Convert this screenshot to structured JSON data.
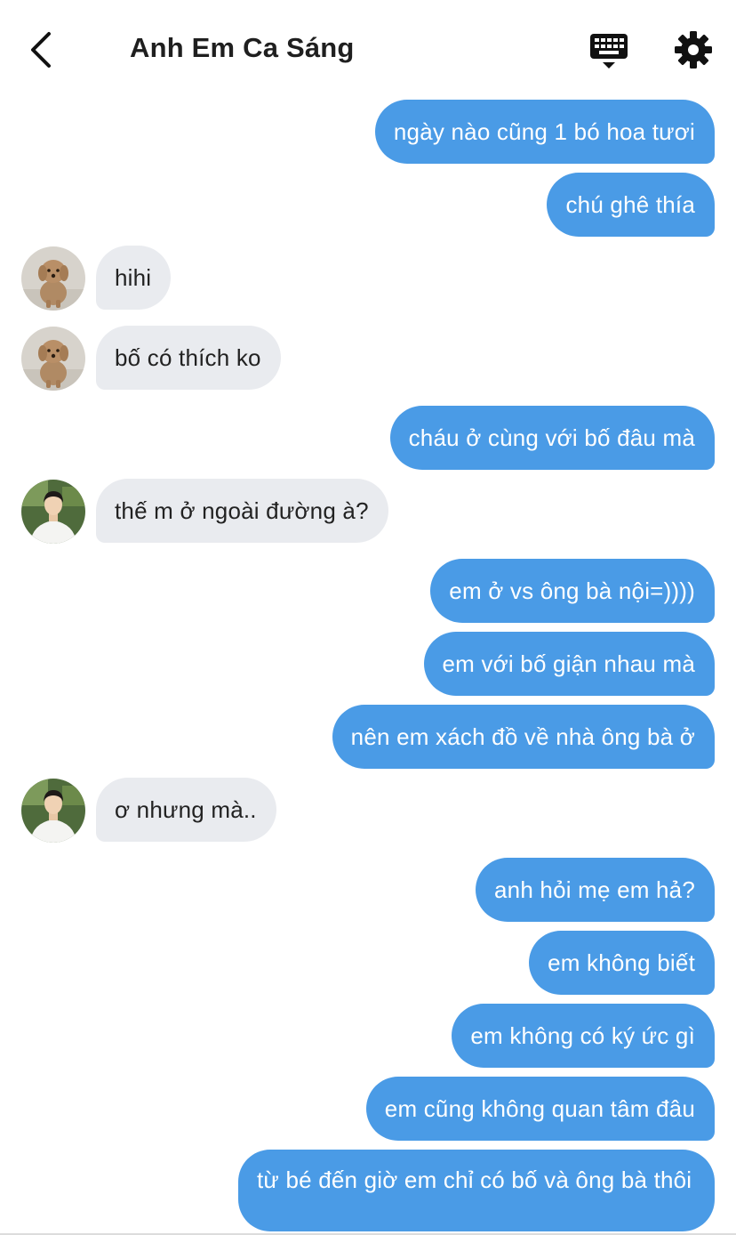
{
  "header": {
    "title": "Anh Em Ca Sáng"
  },
  "icons": {
    "back": "chevron-left-icon",
    "keyboard": "keyboard-icon",
    "settings": "gear-icon"
  },
  "colors": {
    "sent_bubble": "#4a9be6",
    "received_bubble": "#e9ebef"
  },
  "messages": [
    {
      "direction": "sent",
      "text": "ngày nào cũng 1 bó hoa tươi"
    },
    {
      "direction": "sent",
      "text": "chú ghê thía"
    },
    {
      "direction": "received",
      "avatar": "dog-avatar",
      "text": "hihi"
    },
    {
      "direction": "received",
      "avatar": "dog-avatar",
      "text": "bố có thích ko"
    },
    {
      "direction": "sent",
      "text": "cháu ở cùng với bố đâu mà"
    },
    {
      "direction": "received",
      "avatar": "boy-avatar",
      "text": "thế m ở ngoài đường à?"
    },
    {
      "direction": "sent",
      "text": "em ở vs ông bà nội=))))"
    },
    {
      "direction": "sent",
      "text": "em với bố giận nhau mà"
    },
    {
      "direction": "sent",
      "text": "nên em xách đồ về nhà ông bà ở"
    },
    {
      "direction": "received",
      "avatar": "boy-avatar",
      "text": "ơ nhưng mà.."
    },
    {
      "direction": "sent",
      "text": "anh hỏi mẹ em hả?"
    },
    {
      "direction": "sent",
      "text": "em không biết"
    },
    {
      "direction": "sent",
      "text": "em không có ký ức gì"
    },
    {
      "direction": "sent",
      "text": "em cũng không quan tâm đâu"
    },
    {
      "direction": "sent",
      "text": "từ bé đến giờ em chỉ có bố và ông bà thôi"
    }
  ]
}
